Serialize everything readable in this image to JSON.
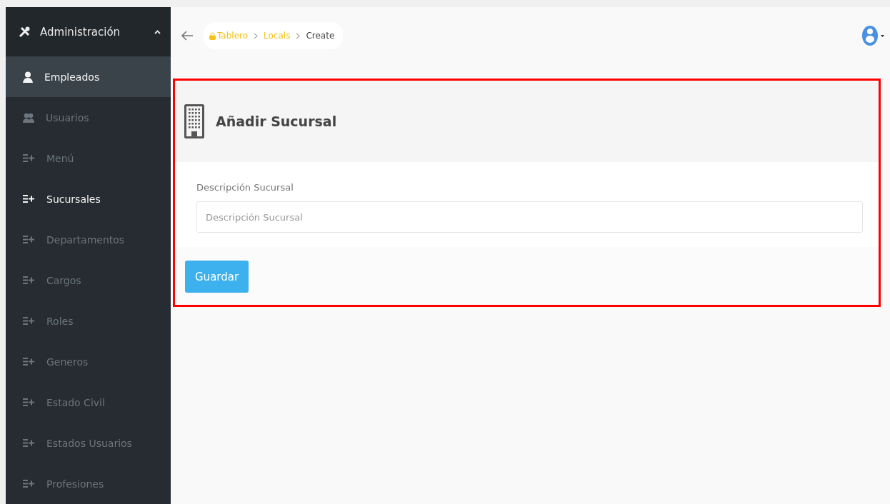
{
  "sidebar": {
    "header": {
      "label": "Administración",
      "expanded": true
    },
    "items": [
      {
        "label": "Empleados",
        "kind": "user",
        "selected": true,
        "active": true
      },
      {
        "label": "Usuarios",
        "kind": "users",
        "selected": false,
        "active": false
      },
      {
        "label": "Menú",
        "kind": "list",
        "selected": false,
        "active": false
      },
      {
        "label": "Sucursales",
        "kind": "list",
        "selected": false,
        "active": true
      },
      {
        "label": "Departamentos",
        "kind": "list",
        "selected": false,
        "active": false
      },
      {
        "label": "Cargos",
        "kind": "list",
        "selected": false,
        "active": false
      },
      {
        "label": "Roles",
        "kind": "list",
        "selected": false,
        "active": false
      },
      {
        "label": "Generos",
        "kind": "list",
        "selected": false,
        "active": false
      },
      {
        "label": "Estado Civil",
        "kind": "list",
        "selected": false,
        "active": false
      },
      {
        "label": "Estados Usuarios",
        "kind": "list",
        "selected": false,
        "active": false
      },
      {
        "label": "Profesiones",
        "kind": "list",
        "selected": false,
        "active": false
      }
    ]
  },
  "breadcrumb": [
    {
      "label": "Tablero",
      "kind": "link"
    },
    {
      "label": "Locals",
      "kind": "link"
    },
    {
      "label": "Create",
      "kind": "current"
    }
  ],
  "panel": {
    "title": "Añadir Sucursal",
    "field": {
      "label": "Descripción Sucursal",
      "placeholder": "Descripción Sucursal"
    },
    "button": "Guardar"
  }
}
